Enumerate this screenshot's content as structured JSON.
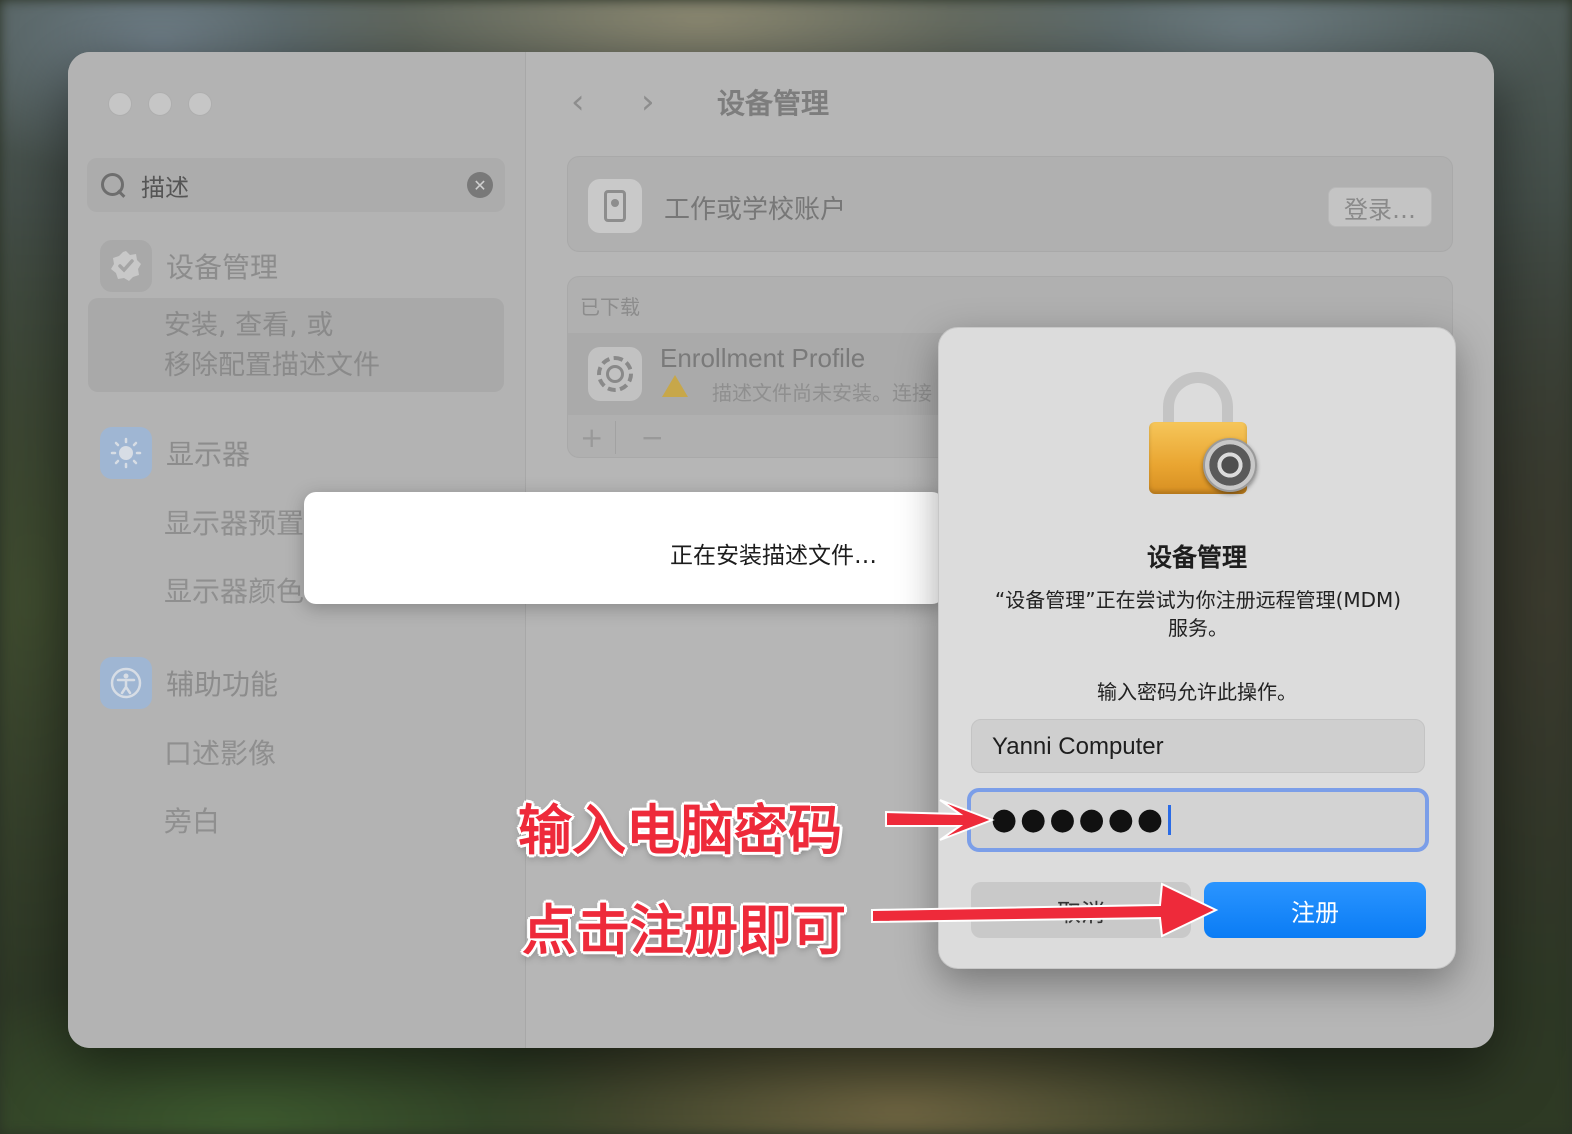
{
  "window": {
    "nav_title": "设备管理",
    "back_glyph": "‹",
    "forward_glyph": "›"
  },
  "sidebar": {
    "search": {
      "value": "描述",
      "icon": "magnifier-icon",
      "clear_icon": "clear-icon"
    },
    "items": [
      {
        "label": "设备管理",
        "icon": "device-management-check-icon",
        "icon_color": "#a9a9a9"
      },
      {
        "label": "显示器",
        "icon": "brightness-icon",
        "icon_color": "#9fb6d3"
      },
      {
        "label": "辅助功能",
        "icon": "accessibility-icon",
        "icon_color": "#9fb6d3"
      }
    ],
    "selected_result_line1": "安装, 查看, 或",
    "selected_result_line2": "移除配置描述文件",
    "sub_results": [
      "显示器预置",
      "显示器颜色",
      "口述影像",
      "旁白"
    ]
  },
  "main": {
    "account_label": "工作或学校账户",
    "login_button": "登录…",
    "downloaded_header": "已下载",
    "profile_name": "Enrollment Profile",
    "profile_status": "描述文件尚未安装。连接",
    "add_button": "+",
    "remove_button": "−"
  },
  "progress": {
    "text": "正在安装描述文件…"
  },
  "dialog": {
    "title": "设备管理",
    "message": "“设备管理”正在尝试为你注册远程管理(MDM)服务。",
    "prompt": "输入密码允许此操作。",
    "username": "Yanni Computer",
    "password_mask": "●●●●●●",
    "cancel": "取消",
    "register": "注册",
    "accent": "#0a7cf5"
  },
  "annotations": {
    "enter_password": "输入电脑密码",
    "click_register": "点击注册即可",
    "color": "#ee2a3a"
  }
}
